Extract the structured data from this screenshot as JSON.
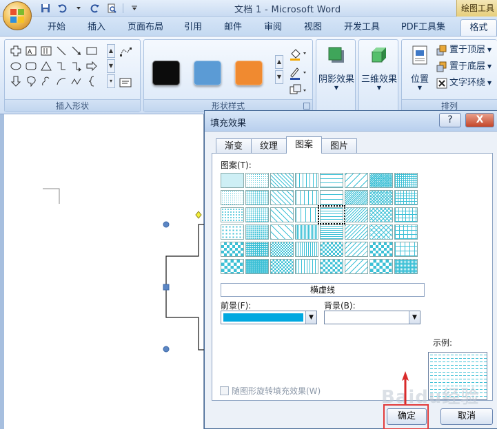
{
  "window": {
    "title": "文档 1 - Microsoft Word",
    "context_tab_title": "绘图工具"
  },
  "quick_access": {
    "icons": [
      "save-icon",
      "undo-icon",
      "redo-icon",
      "print-preview-icon",
      "customize-arrow-icon"
    ]
  },
  "tabs": [
    {
      "label": "开始"
    },
    {
      "label": "插入"
    },
    {
      "label": "页面布局"
    },
    {
      "label": "引用"
    },
    {
      "label": "邮件"
    },
    {
      "label": "审阅"
    },
    {
      "label": "视图"
    },
    {
      "label": "开发工具"
    },
    {
      "label": "PDF工具集"
    },
    {
      "label": "格式"
    }
  ],
  "ribbon": {
    "groups": {
      "insert_shapes": "插入形状",
      "shape_styles": "形状样式",
      "arrange": "排列"
    },
    "shape_style_colors": [
      "#0c0c0c",
      "#5b9bd5",
      "#f08a30"
    ],
    "shadow_effect": "阴影效果",
    "three_d_effect": "三维效果",
    "position": "位置",
    "bring_to_front": "置于顶层",
    "send_to_back": "置于底层",
    "text_wrap": "文字环绕"
  },
  "dialog": {
    "title": "填充效果",
    "help_label": "?",
    "close_label": "X",
    "tabs": [
      {
        "label": "渐变"
      },
      {
        "label": "纹理"
      },
      {
        "label": "图案"
      },
      {
        "label": "图片"
      }
    ],
    "active_tab": "图案",
    "pattern_label": "图案(T):",
    "selected_pattern_name": "横虚线",
    "foreground_label": "前景(F):",
    "background_label": "背景(B):",
    "foreground_color": "#00a8e0",
    "background_color": "#ffffff",
    "pattern_color": "#3cc0d6",
    "sample_label": "示例:",
    "rotate_label": "随图形旋转填充效果(W)",
    "ok_label": "确定",
    "cancel_label": "取消"
  },
  "watermark": "Baidu经验"
}
